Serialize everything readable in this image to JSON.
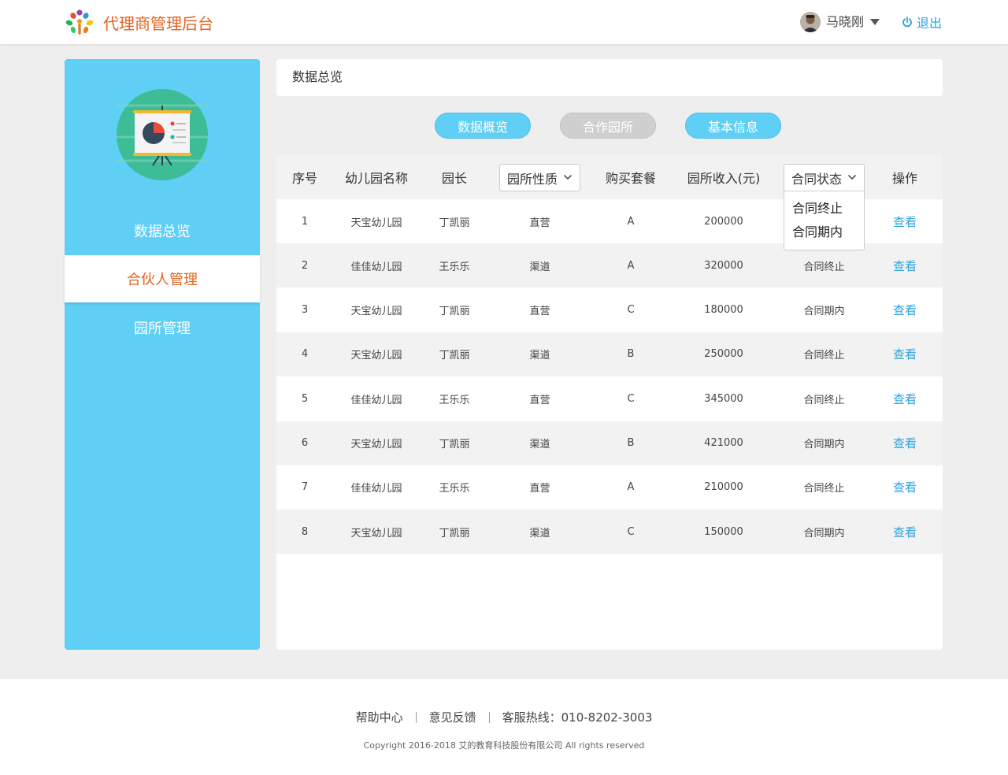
{
  "header": {
    "app_title": "代理商管理后台",
    "user_name": "马晓刚",
    "logout_label": "退出",
    "logo_icon": "colorful-flower-people-logo",
    "colors": {
      "brand": "#e8621c",
      "accent": "#2ba3e0"
    }
  },
  "sidebar": {
    "color": "#5fcff6",
    "illustration_icon": "presentation-board-pie-chart",
    "items": [
      {
        "label": "数据总览",
        "active": false
      },
      {
        "label": "合伙人管理",
        "active": true
      },
      {
        "label": "园所管理",
        "active": false
      }
    ]
  },
  "main": {
    "page_title": "数据总览",
    "tabs": [
      {
        "label": "数据概览",
        "state": "active"
      },
      {
        "label": "合作园所",
        "state": "inactive"
      },
      {
        "label": "基本信息",
        "state": "active"
      }
    ],
    "table": {
      "headers": {
        "index": "序号",
        "name": "幼儿园名称",
        "principal": "园长",
        "nature_select": "园所性质",
        "package": "购买套餐",
        "income": "园所收入(元)",
        "status_select": "合同状态",
        "action": "操作"
      },
      "status_dropdown_options": [
        "合同终止",
        "合同期内"
      ],
      "rows": [
        {
          "index": "1",
          "name": "天宝幼儿园",
          "principal": "丁凯丽",
          "nature": "直营",
          "package": "A",
          "income": "200000",
          "status": "",
          "action": "查看"
        },
        {
          "index": "2",
          "name": "佳佳幼儿园",
          "principal": "王乐乐",
          "nature": "渠道",
          "package": "A",
          "income": "320000",
          "status": "合同终止",
          "action": "查看"
        },
        {
          "index": "3",
          "name": "天宝幼儿园",
          "principal": "丁凯丽",
          "nature": "直营",
          "package": "C",
          "income": "180000",
          "status": "合同期内",
          "action": "查看"
        },
        {
          "index": "4",
          "name": "天宝幼儿园",
          "principal": "丁凯丽",
          "nature": "渠道",
          "package": "B",
          "income": "250000",
          "status": "合同终止",
          "action": "查看"
        },
        {
          "index": "5",
          "name": "佳佳幼儿园",
          "principal": "王乐乐",
          "nature": "直营",
          "package": "C",
          "income": "345000",
          "status": "合同终止",
          "action": "查看"
        },
        {
          "index": "6",
          "name": "天宝幼儿园",
          "principal": "丁凯丽",
          "nature": "渠道",
          "package": "B",
          "income": "421000",
          "status": "合同期内",
          "action": "查看"
        },
        {
          "index": "7",
          "name": "佳佳幼儿园",
          "principal": "王乐乐",
          "nature": "直营",
          "package": "A",
          "income": "210000",
          "status": "合同终止",
          "action": "查看"
        },
        {
          "index": "8",
          "name": "天宝幼儿园",
          "principal": "丁凯丽",
          "nature": "渠道",
          "package": "C",
          "income": "150000",
          "status": "合同期内",
          "action": "查看"
        }
      ]
    }
  },
  "footer": {
    "links": [
      "帮助中心",
      "意见反馈",
      "客服热线：010-8202-3003"
    ],
    "copyright": "Copyright 2016-2018 艾的教育科技股份有限公司 All rights reserved"
  }
}
